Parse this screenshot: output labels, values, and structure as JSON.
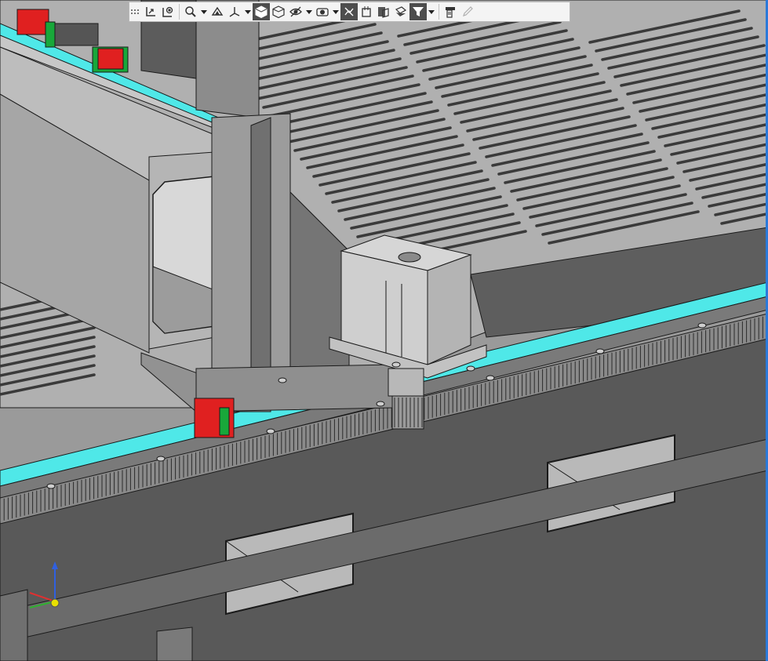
{
  "window": {
    "accent_color": "#2b79d9"
  },
  "toolbar": {
    "buttons": [
      {
        "icon": "zoom-to-fit-icon"
      },
      {
        "icon": "zoom-to-area-icon"
      },
      {
        "icon": "zoom-dropdown-icon"
      },
      {
        "icon": "section-view-icon"
      },
      {
        "icon": "view-orientation-icon"
      },
      {
        "icon": "display-style-shaded-edges-icon",
        "active": true
      },
      {
        "icon": "display-style-shaded-icon"
      },
      {
        "icon": "hide-show-items-icon"
      },
      {
        "icon": "edit-appearance-icon"
      },
      {
        "icon": "apply-scene-icon",
        "active": true
      },
      {
        "icon": "view-settings-icon"
      },
      {
        "icon": "realview-icon"
      },
      {
        "icon": "selection-filter-icon",
        "active": true
      },
      {
        "icon": "print-preview-icon"
      },
      {
        "icon": "pencil-icon",
        "disabled": true
      }
    ]
  },
  "model": {
    "colors": {
      "table_top": "#b4b4b4",
      "slot": "#404040",
      "frame_dark": "#5a5a5a",
      "rail_cyan": "#4fe8e8",
      "rack": "#8a8a8a",
      "block_red": "#e02020",
      "block_green": "#18a83a",
      "motor_body": "#c8c8c8",
      "gantry_beam": "#a8a8a8",
      "edge_line": "#1a1a1a",
      "highlight_red": "#cc0000"
    }
  },
  "triad": {
    "axes": [
      "x",
      "y",
      "z"
    ],
    "colors": {
      "x": "#e03030",
      "y": "#30b030",
      "z": "#3060e0"
    }
  }
}
